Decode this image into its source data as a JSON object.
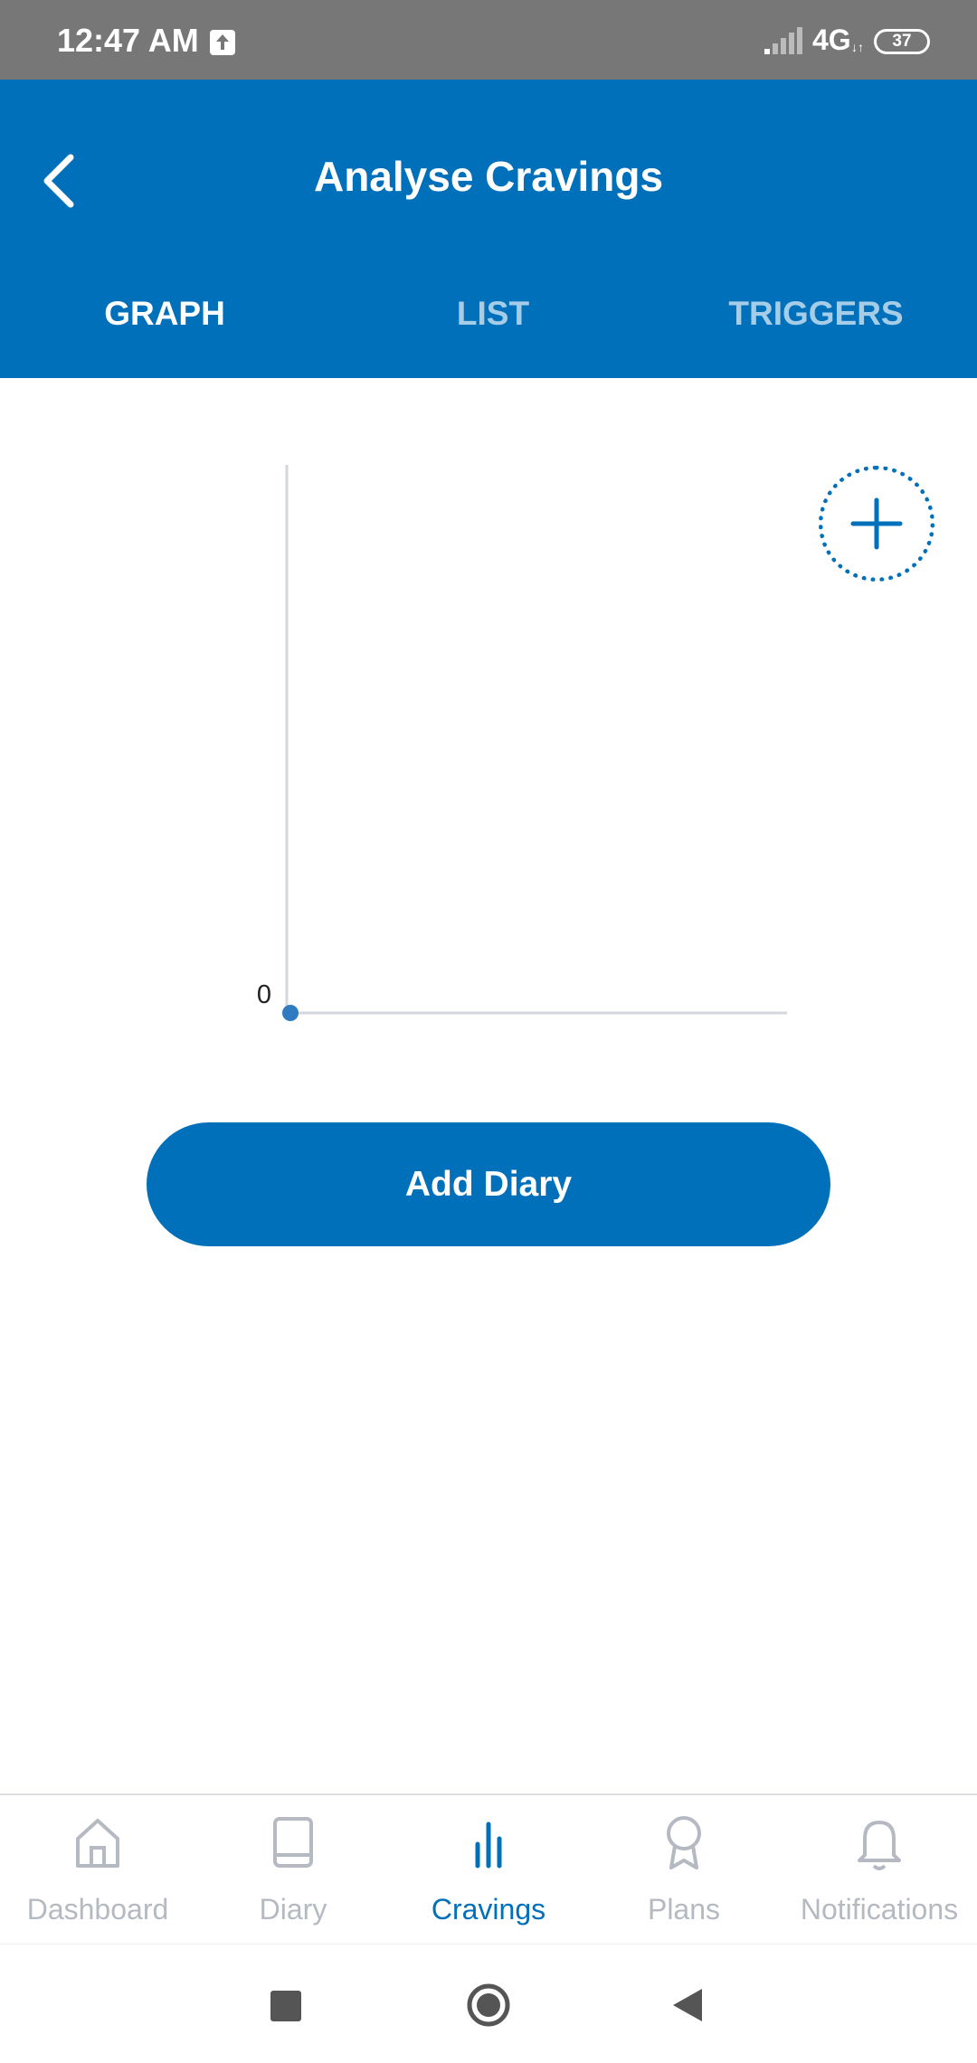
{
  "status_bar": {
    "time": "12:47 AM",
    "network": "4G",
    "network_arrows": "↓↑",
    "battery": "37"
  },
  "header": {
    "title": "Analyse Cravings",
    "back_icon": "chevron-left-icon"
  },
  "tabs": [
    {
      "label": "GRAPH",
      "active": true
    },
    {
      "label": "LIST",
      "active": false
    },
    {
      "label": "TRIGGERS",
      "active": false
    }
  ],
  "chart_data": {
    "type": "line",
    "series": [
      {
        "values": [
          0
        ]
      }
    ],
    "y_tick_labels": [
      "0"
    ],
    "point_color": "#2F7BBF"
  },
  "fab": {
    "icon": "plus-icon"
  },
  "add_diary_button": {
    "label": "Add Diary"
  },
  "bottom_nav": [
    {
      "label": "Dashboard",
      "icon": "home-icon",
      "active": false
    },
    {
      "label": "Diary",
      "icon": "book-icon",
      "active": false
    },
    {
      "label": "Cravings",
      "icon": "bar-chart-icon",
      "active": true
    },
    {
      "label": "Plans",
      "icon": "award-icon",
      "active": false
    },
    {
      "label": "Notifications",
      "icon": "bell-icon",
      "active": false
    }
  ],
  "colors": {
    "brand": "#0170BB",
    "inactive": "#B4B9C2",
    "status_bar": "#777777"
  }
}
